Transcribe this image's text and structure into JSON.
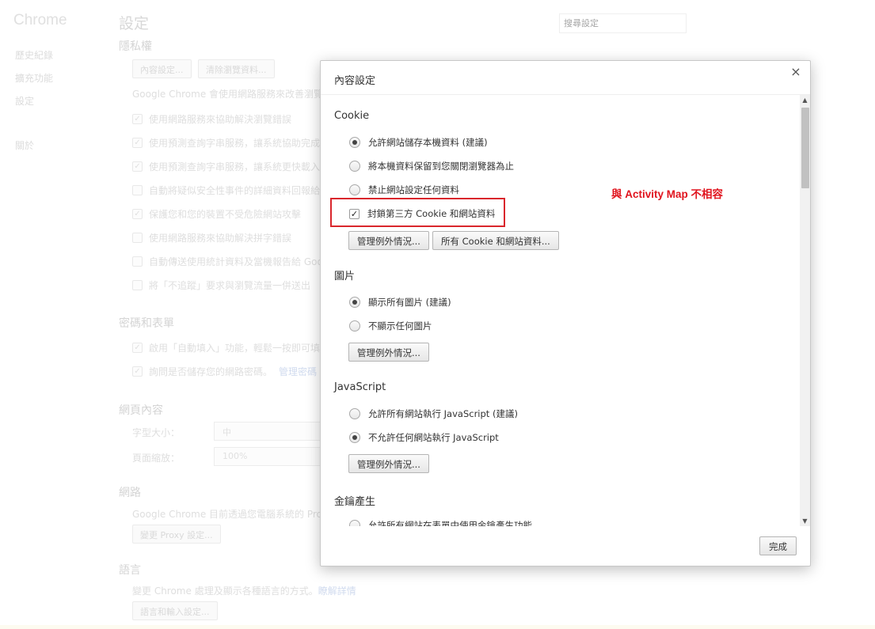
{
  "background": {
    "brand": "Chrome",
    "nav": [
      "歷史紀錄",
      "擴充功能",
      "設定",
      "關於"
    ],
    "page_title": "設定",
    "search_placeholder": "搜尋設定",
    "privacy": {
      "heading": "隱私權",
      "buttons": [
        "內容設定...",
        "清除瀏覽資料..."
      ],
      "description": "Google Chrome 會使用網路服務來改善瀏覽體",
      "options": [
        {
          "label": "使用網路服務來協助解決瀏覽錯誤",
          "checked": true
        },
        {
          "label": "使用預測查詢字串服務，讓系統協助完成",
          "checked": true
        },
        {
          "label": "使用預測查詢字串服務，讓系統更快載入",
          "checked": true
        },
        {
          "label": "自動將疑似安全性事件的詳細資料回報給",
          "checked": false
        },
        {
          "label": "保護您和您的裝置不受危險網站攻擊",
          "checked": true
        },
        {
          "label": "使用網路服務來協助解決拼字錯誤",
          "checked": false
        },
        {
          "label": "自動傳送使用統計資料及當機報告給 Goo",
          "checked": false
        },
        {
          "label": "將「不追蹤」要求與瀏覽流量一併送出",
          "checked": false
        }
      ]
    },
    "passwords": {
      "heading": "密碼和表單",
      "options": [
        {
          "label": "啟用「自動填入」功能，輕鬆一按即可填",
          "checked": true
        },
        {
          "label": "詢問是否儲存您的網路密碼。",
          "link": "管理密碼",
          "checked": true
        }
      ]
    },
    "web_content": {
      "heading": "網頁內容",
      "font_size_label": "字型大小：",
      "font_size_value": "中",
      "zoom_label": "頁面縮放：",
      "zoom_value": "100%"
    },
    "network": {
      "heading": "網路",
      "description": "Google Chrome 目前透過您電腦系統的 Proxy",
      "button": "變更 Proxy 設定..."
    },
    "languages": {
      "heading": "語言",
      "description": "變更 Chrome 處理及顯示各種語言的方式。",
      "link": "瞭解詳情",
      "button": "語言和輸入設定..."
    }
  },
  "dialog": {
    "title": "內容設定",
    "close_symbol": "×",
    "annotation": "與 Activity Map 不相容",
    "cookie": {
      "title": "Cookie",
      "options": [
        {
          "label": "允許網站儲存本機資料 (建議)",
          "selected": true
        },
        {
          "label": "將本機資料保留到您關閉瀏覽器為止",
          "selected": false
        },
        {
          "label": "禁止網站設定任何資料",
          "selected": false
        }
      ],
      "block_third_party": {
        "label": "封鎖第三方 Cookie 和網站資料",
        "checked": true
      },
      "buttons": [
        "管理例外情況...",
        "所有 Cookie 和網站資料..."
      ]
    },
    "images": {
      "title": "圖片",
      "options": [
        {
          "label": "顯示所有圖片 (建議)",
          "selected": true
        },
        {
          "label": "不顯示任何圖片",
          "selected": false
        }
      ],
      "button": "管理例外情況..."
    },
    "javascript": {
      "title": "JavaScript",
      "options": [
        {
          "label": "允許所有網站執行 JavaScript (建議)",
          "selected": false
        },
        {
          "label": "不允許任何網站執行 JavaScript",
          "selected": true
        }
      ],
      "button": "管理例外情況..."
    },
    "key_generation": {
      "title": "金鑰產生",
      "options": [
        {
          "label": "允許所有網站在表單中使用金鑰產生功能。",
          "selected": false
        }
      ]
    },
    "done_button": "完成"
  }
}
